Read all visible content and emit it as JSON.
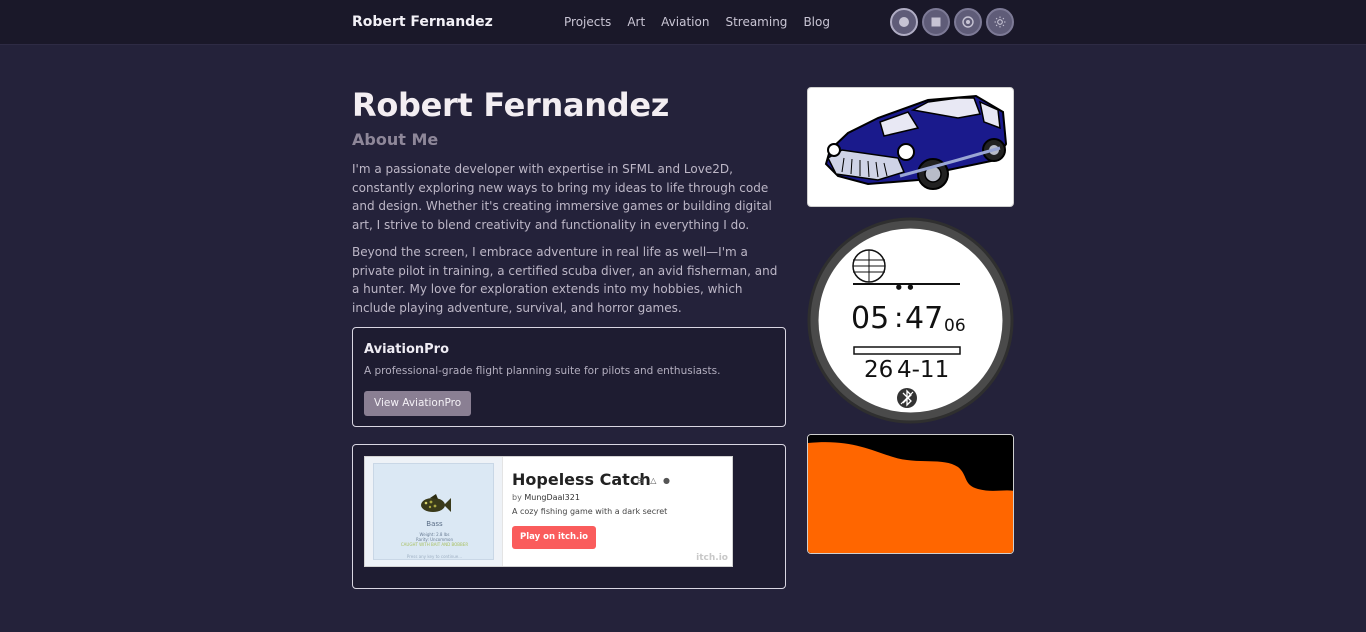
{
  "nav": {
    "brand": "Robert Fernandez",
    "links": [
      "Projects",
      "Art",
      "Aviation",
      "Streaming",
      "Blog"
    ],
    "theme_buttons": [
      "circle-theme-icon",
      "square-theme-icon",
      "globe-theme-icon",
      "sun-theme-icon"
    ]
  },
  "hero": {
    "title": "Robert Fernandez",
    "subtitle": "About Me",
    "paragraph1": "I'm a passionate developer with expertise in SFML and Love2D, constantly exploring new ways to bring my ideas to life through code and design. Whether it's creating immersive games or building digital art, I strive to blend creativity and functionality in everything I do.",
    "paragraph2": "Beyond the screen, I embrace adventure in real life as well—I'm a private pilot in training, a certified scuba diver, an avid fisherman, and a hunter. My love for exploration extends into my hobbies, which include playing adventure, survival, and horror games."
  },
  "aviation_card": {
    "title": "AviationPro",
    "description": "A professional-grade flight planning suite for pilots and enthusiasts.",
    "button": "View AviationPro"
  },
  "itch_embed": {
    "title": "Hopeless Catch",
    "platforms": "⊞ △ ●",
    "by_label": "by",
    "author": "MungDaal321",
    "tagline": "A cozy fishing game with a dark secret",
    "play_button": "Play on itch.io",
    "logo": "itch.io",
    "thumb": {
      "fish_name": "Bass",
      "weight": "Weight: 2.8 lbs",
      "rarity": "Rarity: Uncommon",
      "note": "CAUGHT WITH BAIT AND BOBBER",
      "hint": "Press any key to continue..."
    }
  },
  "watch": {
    "hours": "05",
    "separator": ":",
    "minutes": "47",
    "seconds": "06",
    "date_left": "26",
    "date_right": "4-11",
    "status_glyph": "••"
  },
  "colors": {
    "background": "#24223a",
    "navbar": "#1a1829",
    "card_button": "#8a7f93",
    "itch_play": "#fa5c5c",
    "orange": "#ff6600",
    "car_blue": "#1a1a8c"
  }
}
